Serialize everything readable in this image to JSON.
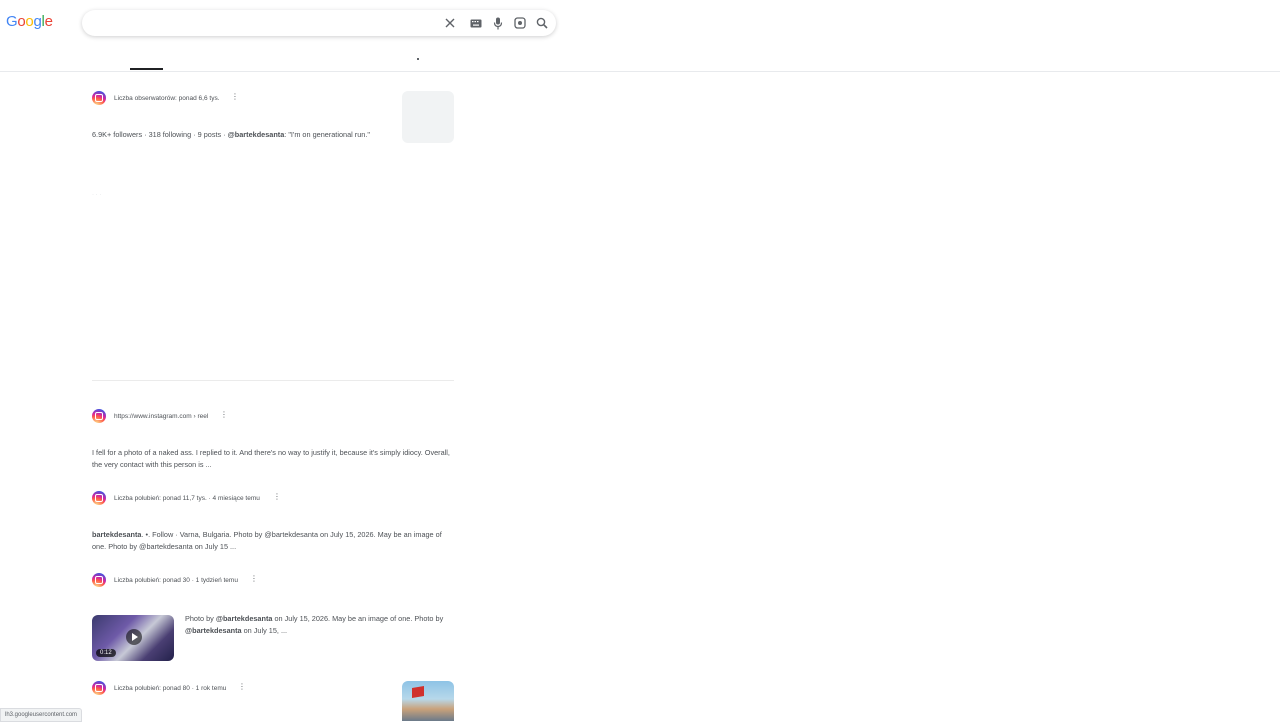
{
  "logo": {
    "text": "Google",
    "letters": [
      {
        "ch": "G",
        "color": "#4285F4"
      },
      {
        "ch": "o",
        "color": "#EA4335"
      },
      {
        "ch": "o",
        "color": "#FBBC05"
      },
      {
        "ch": "g",
        "color": "#4285F4"
      },
      {
        "ch": "l",
        "color": "#34A853"
      },
      {
        "ch": "e",
        "color": "#EA4335"
      }
    ]
  },
  "search": {
    "value": "",
    "placeholder": ""
  },
  "icons": {
    "clear": "close-icon",
    "keyboard": "keyboard-icon",
    "voice": "mic-icon",
    "lens": "camera-lens-icon",
    "search": "search-icon"
  },
  "results": [
    {
      "source": "Liczba obserwatorów: ponad 6,6 tys.",
      "snippet_plain": "6.9K+ followers · 318 following · 9 posts · ",
      "snippet_bold": "@bartekdesanta",
      "snippet_tail": ": \"I'm on generational run.\""
    },
    {
      "source": "https://www.instagram.com › reel",
      "snippet": "I fell for a photo of a naked ass. I replied to it. And there's no way to justify it, because it's simply idiocy. Overall, the very contact with this person is ..."
    },
    {
      "source": "Liczba polubień: ponad 11,7 tys. · 4 miesiące temu",
      "snippet_bold": "bartekdesanta",
      "snippet_tail": ". •. Follow · Varna, Bulgaria. Photo by @bartekdesanta on July 15, 2026. May be an image of one. Photo by @bartekdesanta on July 15 ..."
    },
    {
      "source": "Liczba polubień: ponad 30 · 1 tydzień temu",
      "snippet_a": "Photo by ",
      "snippet_b1": "@bartekdesanta",
      "snippet_c": " on July 15, 2026. May be an image of one. Photo by ",
      "snippet_b2": "@bartekdesanta",
      "snippet_d": " on July 15, ...",
      "video_duration": "0:12"
    },
    {
      "source": "Liczba polubień: ponad 80 · 1 rok temu"
    }
  ],
  "status_bar": {
    "url": "lh3.googleusercontent.com"
  },
  "faint_ellipsis": "· · ·"
}
